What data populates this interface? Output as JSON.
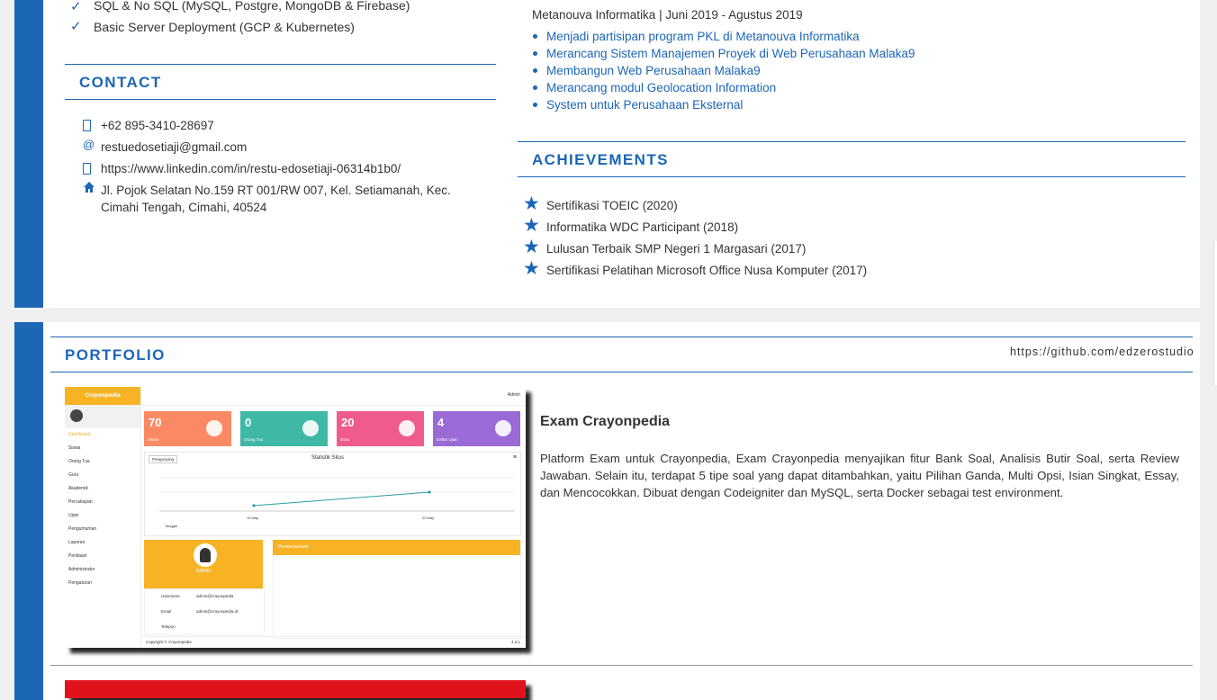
{
  "skills": [
    "SQL & No SQL (MySQL, Postgre, MongoDB & Firebase)",
    "Basic Server Deployment (GCP & Kubernetes)"
  ],
  "contact": {
    "title": "CONTACT",
    "phone": "+62 895-3410-28697",
    "email": "restuedosetiaji@gmail.com",
    "linkedin": "https://www.linkedin.com/in/restu-edosetiaji-06314b1b0/",
    "address": "Jl. Pojok Selatan No.159 RT 001/RW 007, Kel. Setiamanah, Kec. Cimahi Tengah, Cimahi, 40524"
  },
  "experience": {
    "heading": "Metanouva Informatika | Juni 2019 - Agustus 2019",
    "items": [
      "Menjadi partisipan program PKL di Metanouva Informatika",
      "Merancang Sistem Manajemen Proyek di Web Perusahaan Malaka9",
      "Membangun Web Perusahaan Malaka9",
      "Merancang modul Geolocation Information",
      "System untuk Perusahaan Eksternal"
    ]
  },
  "achievements": {
    "title": "ACHIEVEMENTS",
    "items": [
      "Sertifikasi TOEIC (2020)",
      "Informatika WDC Participant (2018)",
      "Lulusan Terbaik SMP Negeri 1 Margasari (2017)",
      "Sertifikasi Pelatihan Microsoft Office Nusa Komputer (2017)"
    ]
  },
  "portfolio": {
    "title": "PORTFOLIO",
    "github": "https://github.com/edzerostudio",
    "project_title": "Exam Crayonpedia",
    "project_desc": "Platform Exam untuk Crayonpedia, Exam Crayonpedia menyajikan fitur Bank Soal, Analisis Butir Soal, serta Review Jawaban. Selain itu, terdapat 5 tipe soal yang dapat ditambahkan, yaitu Pilihan Ganda, Multi Opsi, Isian Singkat, Essay, dan Mencocokkan. Dibuat dengan Codeigniter dan MySQL, serta Docker sebagai test environment."
  },
  "screenshot": {
    "brand": "Crayonpedia",
    "menu": [
      "Dashboard",
      "Siswa",
      "Orang Tua",
      "Guru",
      "Akademik",
      "Percakapan",
      "Ujian",
      "Pengumuman",
      "Laporan",
      "Penilaian",
      "Administrator",
      "Pengaturan"
    ],
    "tiles": [
      {
        "num": "70",
        "label": "Siswa",
        "color": "#fb8a64"
      },
      {
        "num": "0",
        "label": "Orang Tua",
        "color": "#3fb9a6"
      },
      {
        "num": "20",
        "label": "Guru",
        "color": "#ef5b8c"
      },
      {
        "num": "4",
        "label": "Daftar Ujian",
        "color": "#9a6ad6"
      }
    ],
    "chart_title": "Statistik Situs",
    "chart_legend": "Pengunjung",
    "chart_x": [
      "15 May",
      "20 May"
    ],
    "chart_xlabel": "Tanggal",
    "chart_ylabel": "Pengunjung",
    "profile_name": "Admin",
    "profile_role": "Admin",
    "profile_rows": [
      {
        "k": "Username",
        "v": "admin@crayonpedia"
      },
      {
        "k": "Email",
        "v": "admin@crayonpedia.id"
      },
      {
        "k": "Telepon",
        "v": ""
      }
    ],
    "panel_title": "Pemberitahuan",
    "user": "Admin",
    "footer": "Copyright © Crayonpedia",
    "version": "4.3.1"
  },
  "colors": {
    "accent": "#1c66b6",
    "brand_orange": "#f7b324",
    "next_thumb": "#e0121b"
  }
}
